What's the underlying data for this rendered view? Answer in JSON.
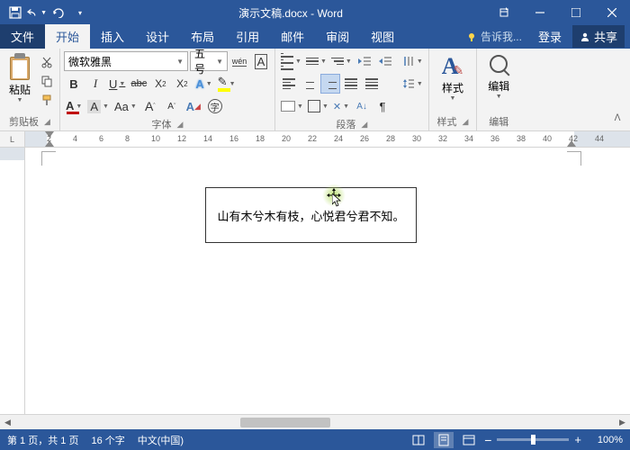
{
  "titlebar": {
    "title": "演示文稿.docx - Word"
  },
  "tabs": {
    "file": "文件",
    "home": "开始",
    "insert": "插入",
    "design": "设计",
    "layout": "布局",
    "references": "引用",
    "mailings": "邮件",
    "review": "审阅",
    "view": "视图",
    "tellme": "告诉我...",
    "signin": "登录",
    "share": "共享"
  },
  "ribbon": {
    "clipboard": {
      "paste": "粘贴",
      "group": "剪贴板"
    },
    "font": {
      "name": "微软雅黑",
      "size": "五号",
      "group": "字体",
      "ruby": "wén",
      "charborder": "A",
      "bold": "B",
      "italic": "I",
      "underline": "U",
      "strike": "abc",
      "sub": "X₂",
      "sup": "X²",
      "grow": "A",
      "shrink": "A",
      "clearfmt": "A",
      "highlight": "ab",
      "fontcolor": "A",
      "charshade": "A",
      "enclose": "字"
    },
    "paragraph": {
      "group": "段落"
    },
    "styles": {
      "label": "样式",
      "group": "样式"
    },
    "editing": {
      "label": "编辑",
      "group": "编辑"
    }
  },
  "ruler": {
    "corner": "L",
    "nums": [
      2,
      4,
      6,
      8,
      10,
      12,
      14,
      16,
      18,
      20,
      22,
      24,
      26,
      28,
      30,
      32,
      34,
      36,
      38,
      40,
      42,
      44
    ]
  },
  "document": {
    "textbox": "山有木兮木有枝，心悦君兮君不知。"
  },
  "statusbar": {
    "page": "第 1 页，共 1 页",
    "words": "16 个字",
    "lang": "中文(中国)",
    "zoom": "100%",
    "zoom_minus": "−",
    "zoom_plus": "+"
  }
}
